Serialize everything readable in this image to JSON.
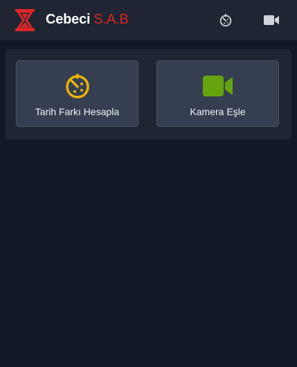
{
  "header": {
    "brand_first": "Cebeci",
    "brand_second": "S.A.B",
    "logo_icon": "hourglass-logo-icon",
    "nav_icons": [
      "timer-icon",
      "video-camera-icon"
    ]
  },
  "cards": [
    {
      "label": "Tarih Farkı Hesapla",
      "icon": "timer-icon",
      "icon_color": "#eab308"
    },
    {
      "label": "Kamera Eşle",
      "icon": "video-camera-icon",
      "icon_color": "#65a30d"
    }
  ],
  "colors": {
    "background": "#121826",
    "header_bg": "#1f2532",
    "card_bg": "#363f51",
    "brand_red": "#dc2626"
  }
}
